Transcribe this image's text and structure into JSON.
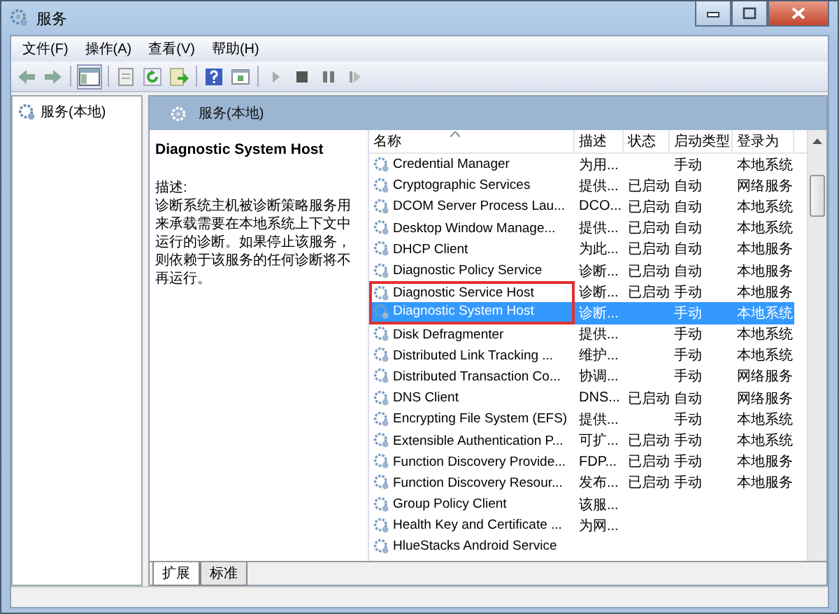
{
  "window": {
    "title": "服务"
  },
  "menu": [
    "文件(F)",
    "操作(A)",
    "查看(V)",
    "帮助(H)"
  ],
  "tree": {
    "items": [
      {
        "label": "服务(本地)",
        "selected": false
      }
    ]
  },
  "pane_header": {
    "title": "服务(本地)"
  },
  "details": {
    "title": "Diagnostic System Host",
    "desc_label": "描述:",
    "description": "诊断系统主机被诊断策略服务用来承载需要在本地系统上下文中运行的诊断。如果停止该服务，则依赖于该服务的任何诊断将不再运行。"
  },
  "table": {
    "columns": [
      "名称",
      "描述",
      "状态",
      "启动类型",
      "登录为"
    ],
    "rows": [
      {
        "cells": [
          "Credential Manager",
          "为用...",
          "",
          "手动",
          "本地系统"
        ],
        "selected": false,
        "boxed": false
      },
      {
        "cells": [
          "Cryptographic Services",
          "提供...",
          "已启动",
          "自动",
          "网络服务"
        ],
        "selected": false,
        "boxed": false
      },
      {
        "cells": [
          "DCOM Server Process Lau...",
          "DCO...",
          "已启动",
          "自动",
          "本地系统"
        ],
        "selected": false,
        "boxed": false
      },
      {
        "cells": [
          "Desktop Window Manage...",
          "提供...",
          "已启动",
          "自动",
          "本地系统"
        ],
        "selected": false,
        "boxed": false
      },
      {
        "cells": [
          "DHCP Client",
          "为此...",
          "已启动",
          "自动",
          "本地服务"
        ],
        "selected": false,
        "boxed": false
      },
      {
        "cells": [
          "Diagnostic Policy Service",
          "诊断...",
          "已启动",
          "自动",
          "本地服务"
        ],
        "selected": false,
        "boxed": false
      },
      {
        "cells": [
          "Diagnostic Service Host",
          "诊断...",
          "已启动",
          "手动",
          "本地服务"
        ],
        "selected": false,
        "boxed": true
      },
      {
        "cells": [
          "Diagnostic System Host",
          "诊断...",
          "",
          "手动",
          "本地系统"
        ],
        "selected": true,
        "boxed": true
      },
      {
        "cells": [
          "Disk Defragmenter",
          "提供...",
          "",
          "手动",
          "本地系统"
        ],
        "selected": false,
        "boxed": false
      },
      {
        "cells": [
          "Distributed Link Tracking ...",
          "维护...",
          "",
          "手动",
          "本地系统"
        ],
        "selected": false,
        "boxed": false
      },
      {
        "cells": [
          "Distributed Transaction Co...",
          "协调...",
          "",
          "手动",
          "网络服务"
        ],
        "selected": false,
        "boxed": false
      },
      {
        "cells": [
          "DNS Client",
          "DNS...",
          "已启动",
          "自动",
          "网络服务"
        ],
        "selected": false,
        "boxed": false
      },
      {
        "cells": [
          "Encrypting File System (EFS)",
          "提供...",
          "",
          "手动",
          "本地系统"
        ],
        "selected": false,
        "boxed": false
      },
      {
        "cells": [
          "Extensible Authentication P...",
          "可扩...",
          "已启动",
          "手动",
          "本地系统"
        ],
        "selected": false,
        "boxed": false
      },
      {
        "cells": [
          "Function Discovery Provide...",
          "FDP...",
          "已启动",
          "手动",
          "本地服务"
        ],
        "selected": false,
        "boxed": false
      },
      {
        "cells": [
          "Function Discovery Resour...",
          "发布...",
          "已启动",
          "手动",
          "本地服务"
        ],
        "selected": false,
        "boxed": false
      },
      {
        "cells": [
          "Group Policy Client",
          "该服...",
          "",
          "",
          ""
        ],
        "selected": false,
        "boxed": false
      },
      {
        "cells": [
          "Health Key and Certificate ...",
          "为网...",
          "",
          "",
          ""
        ],
        "selected": false,
        "boxed": false
      },
      {
        "cells": [
          "HlueStacks Android Service",
          "",
          "",
          "",
          ""
        ],
        "selected": false,
        "boxed": false
      }
    ]
  },
  "tabs": [
    {
      "label": "扩展",
      "selected": true
    },
    {
      "label": "标准",
      "selected": false
    }
  ]
}
